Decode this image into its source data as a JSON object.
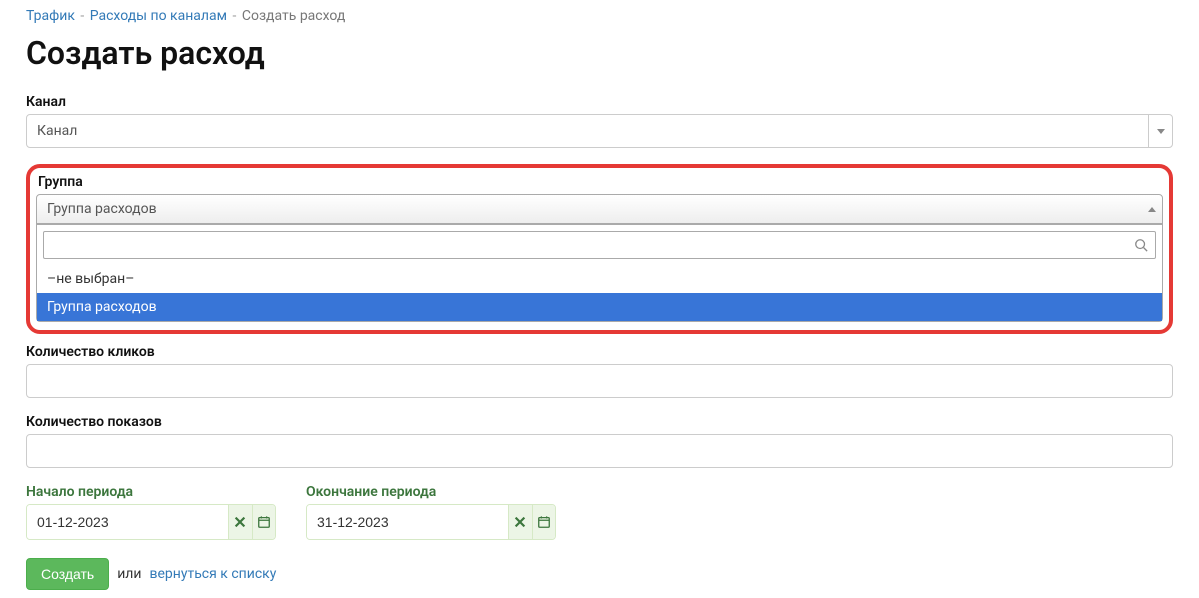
{
  "breadcrumbs": {
    "items": [
      "Трафик",
      "Расходы по каналам",
      "Создать расход"
    ]
  },
  "title": "Создать расход",
  "channel": {
    "label": "Канал",
    "value": "Канал"
  },
  "group": {
    "label": "Группа",
    "value": "Группа расходов",
    "search": "",
    "options": [
      "–не выбран–",
      "Группа расходов"
    ],
    "selected_index": 1
  },
  "clicks": {
    "label": "Количество кликов",
    "value": ""
  },
  "impressions": {
    "label": "Количество показов",
    "value": ""
  },
  "period_start": {
    "label": "Начало периода",
    "value": "01-12-2023"
  },
  "period_end": {
    "label": "Окончание периода",
    "value": "31-12-2023"
  },
  "actions": {
    "create": "Создать",
    "or": "или",
    "back": "вернуться к списку"
  }
}
